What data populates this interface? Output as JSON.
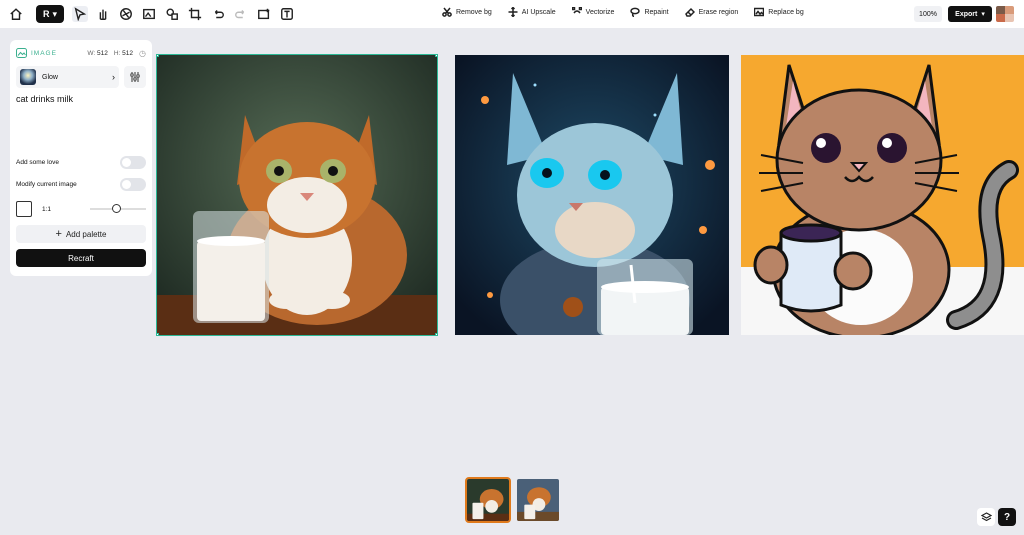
{
  "toolbar": {
    "logo_label": "R",
    "zoom": "100%",
    "export_label": "Export",
    "actions": [
      {
        "label": "Remove bg",
        "icon": "scissors-icon"
      },
      {
        "label": "AI Upscale",
        "icon": "expand-arrows-icon"
      },
      {
        "label": "Vectorize",
        "icon": "vector-path-icon"
      },
      {
        "label": "Repaint",
        "icon": "lasso-icon"
      },
      {
        "label": "Erase region",
        "icon": "eraser-icon"
      },
      {
        "label": "Replace bg",
        "icon": "image-replace-icon"
      }
    ],
    "swatches": [
      "#7a5a48",
      "#d99b7a",
      "#c96a4a",
      "#e8c4b2"
    ]
  },
  "panel": {
    "type_label": "IMAGE",
    "width_label": "W:",
    "width_value": "512",
    "height_label": "H:",
    "height_value": "512",
    "style_name": "Glow",
    "prompt": "cat drinks milk",
    "toggle_love": "Add some love",
    "toggle_modify": "Modify current image",
    "ratio_label": "1:1",
    "add_palette": "Add palette",
    "recraft": "Recraft"
  },
  "accent_color": "#2bb895",
  "help_label": "?"
}
